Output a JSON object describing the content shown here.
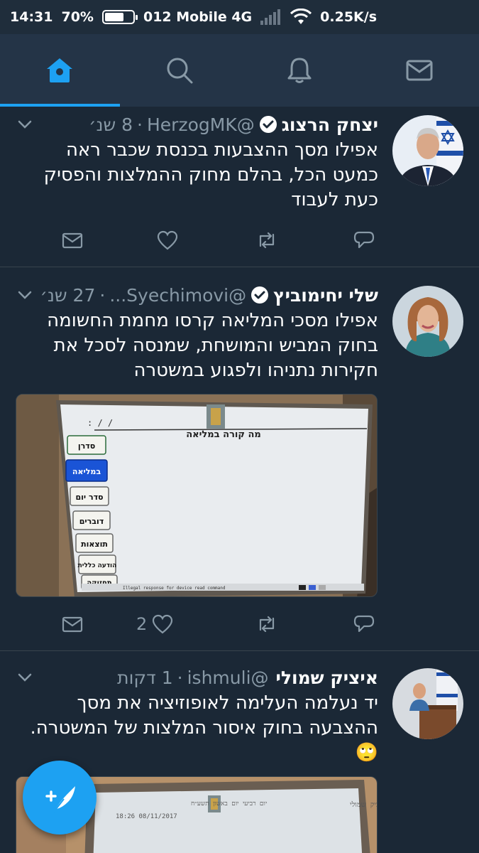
{
  "status_bar": {
    "time": "14:31",
    "battery": "70%",
    "carrier": "012 Mobile 4G",
    "speed": "0.25K/s"
  },
  "nav": {
    "tabs": [
      {
        "name": "home",
        "icon": "home-icon",
        "active": true
      },
      {
        "name": "search",
        "icon": "search-icon",
        "active": false
      },
      {
        "name": "notifications",
        "icon": "bell-icon",
        "active": false
      },
      {
        "name": "messages",
        "icon": "mail-icon",
        "active": false
      }
    ]
  },
  "colors": {
    "background": "#1b2836",
    "nav": "#243447",
    "accent": "#1da1f2",
    "muted": "#8899a6"
  },
  "tweets": [
    {
      "name": "יצחק הרצוג",
      "handle": "@HerzogMK",
      "time": "8 שנ׳",
      "verified": true,
      "text": "אפילו מסך ההצבעות בכנסת שכבר ראה כמעט הכל, בהלם מחוק ההמלצות והפסיק כעת לעבוד",
      "reply_count": "",
      "like_count": ""
    },
    {
      "name": "שלי יחימוביץ",
      "handle": "@Syechimovi...",
      "time": "27 שנ׳",
      "verified": true,
      "text": "אפילו מסכי המליאה קרסו מחמת החשומה בחוק המביש והמושחת, שמנסה לסכל את חקירות נתניהו ולפגוע במשטרה",
      "like_count": "2",
      "media": {
        "title": "מה קורה במליאה",
        "menu": [
          "סדרן",
          "במליאה",
          "סדר יום",
          "דוברים",
          "תוצאות",
          "הודעה כללית",
          "תחזוקה"
        ],
        "status_line": "Illegal response for device read command"
      }
    },
    {
      "name": "איציק שמולי",
      "handle": "@ishmuli",
      "time": "1 דקות",
      "verified": false,
      "text": "יד נעלמה העלימה לאופוזיציה את מסך ההצבעה בחוק איסור המלצות של המשטרה.",
      "emoji": "🙄",
      "media": {
        "screen_name": "איציק שמולי",
        "screen_date": "יום רביעי יום באשון תשע״ח",
        "screen_time": "18:26 08/11/2017"
      }
    }
  ],
  "fab": {
    "icon": "compose-tweet-icon"
  }
}
